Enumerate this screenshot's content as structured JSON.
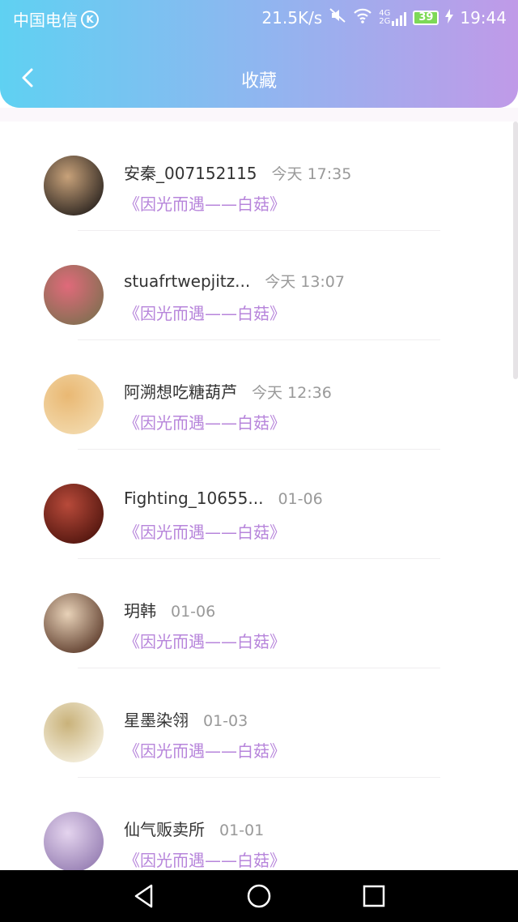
{
  "status_bar": {
    "carrier": "中国电信",
    "carrier_badge": "K",
    "speed": "21.5K/s",
    "network": "4G",
    "network2": "2G",
    "battery": "39",
    "time": "19:44"
  },
  "header": {
    "title": "收藏",
    "back_icon": "chevron-left-icon"
  },
  "items": [
    {
      "name": "安秦_007152115",
      "time": "今天 17:35",
      "book": "《因光而遇——白菇》",
      "avatar_colors": [
        "#3a3028",
        "#c8a27a"
      ]
    },
    {
      "name": "stuafrtwepjitz...",
      "time": "今天 13:07",
      "book": "《因光而遇——白菇》",
      "avatar_colors": [
        "#8a6f55",
        "#e06a7a"
      ]
    },
    {
      "name": "阿溯想吃糖葫芦",
      "time": "今天 12:36",
      "book": "《因光而遇——白菇》",
      "avatar_colors": [
        "#f2d7a8",
        "#e9b873"
      ]
    },
    {
      "name": "Fighting_10655...",
      "time": "01-06",
      "book": "《因光而遇——白菇》",
      "avatar_colors": [
        "#5a1a12",
        "#b84a3a"
      ]
    },
    {
      "name": "玥韩",
      "time": "01-06",
      "book": "《因光而遇——白菇》",
      "avatar_colors": [
        "#6b4b3a",
        "#e8d2b8"
      ]
    },
    {
      "name": "星墨染翎",
      "time": "01-03",
      "book": "《因光而遇——白菇》",
      "avatar_colors": [
        "#f1ead6",
        "#c9b27a"
      ]
    },
    {
      "name": "仙气贩卖所",
      "time": "01-01",
      "book": "《因光而遇——白菇》",
      "avatar_colors": [
        "#9d86b8",
        "#e4d4ee"
      ]
    }
  ],
  "colors": {
    "header_gradient_start": "#5fd1f2",
    "header_gradient_end": "#c09ae8",
    "book_title": "#b785db",
    "name_text": "#333333",
    "time_text": "#999999"
  },
  "nav": {
    "back_icon": "triangle-back-icon",
    "home_icon": "circle-home-icon",
    "recents_icon": "square-recents-icon"
  }
}
